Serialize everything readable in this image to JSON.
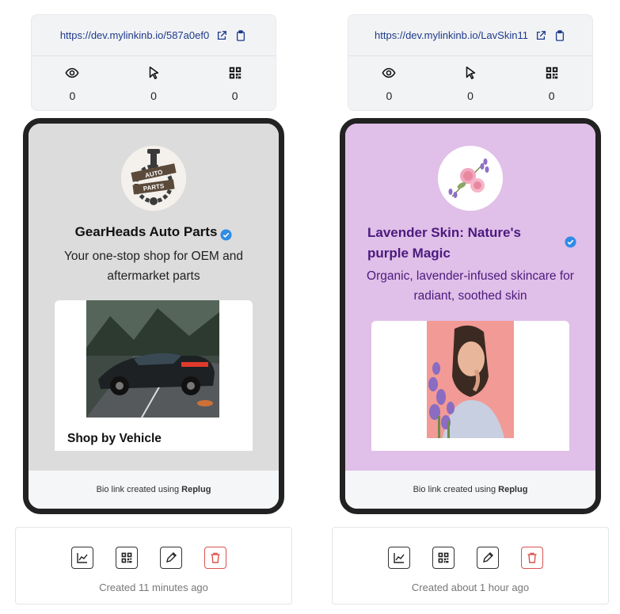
{
  "cards": [
    {
      "link": {
        "url": "https://dev.mylinkinb.io/587a0ef0"
      },
      "stats": {
        "views": "0",
        "clicks": "0",
        "scans": "0"
      },
      "profile": {
        "name": "GearHeads Auto Parts",
        "bio": "Your one-stop shop for OEM and aftermarket parts",
        "logo_text_top": "AUTO",
        "logo_text_bottom": "PARTS",
        "background": "#dcdcdc",
        "name_color": "#111111"
      },
      "content_card": {
        "title": "Shop by Vehicle"
      },
      "footer": {
        "prefix": "Bio link created using",
        "brand": "Replug"
      },
      "created": "Created 11 minutes ago"
    },
    {
      "link": {
        "url": "https://dev.mylinkinb.io/LavSkin11"
      },
      "stats": {
        "views": "0",
        "clicks": "0",
        "scans": "0"
      },
      "profile": {
        "name": "Lavender Skin: Nature's purple Magic",
        "bio": "Organic, lavender-infused skincare for radiant, soothed skin",
        "background": "#e0bfe8",
        "name_color": "#4a1a7e"
      },
      "footer": {
        "prefix": "Bio link created using",
        "brand": "Replug"
      },
      "created": "Created about 1 hour ago"
    }
  ],
  "icons": {
    "external": "external-link-icon",
    "copy": "clipboard-icon",
    "views": "eye-icon",
    "clicks": "cursor-icon",
    "scans": "qr-code-icon",
    "verified": "verified-badge-icon",
    "analytics": "chart-line-icon",
    "qr": "qr-code-icon",
    "edit": "pencil-icon",
    "delete": "trash-icon"
  },
  "colors": {
    "accent_link": "#1e3a8a",
    "verified": "#2f8be6",
    "danger": "#d9534f"
  }
}
